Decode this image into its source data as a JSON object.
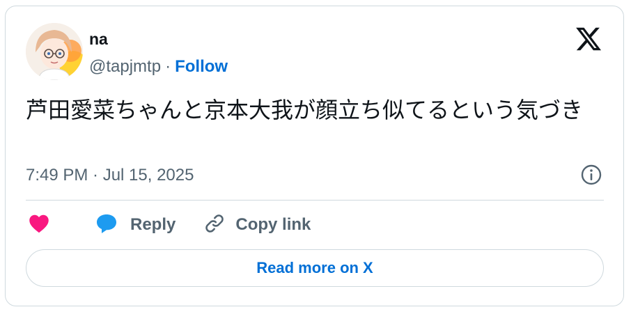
{
  "author": {
    "display_name": "na",
    "handle": "@tapjmtp",
    "separator": "·",
    "follow_label": "Follow"
  },
  "tweet": {
    "text": "芦田愛菜ちゃんと京本大我が顔立ち似てるという気づき",
    "timestamp": "7:49 PM · Jul 15, 2025"
  },
  "actions": {
    "like_icon": "heart-icon",
    "reply_label": "Reply",
    "copy_label": "Copy link"
  },
  "read_more_label": "Read more on X",
  "colors": {
    "accent": "#006fd6",
    "heart": "#f91880",
    "reply_bubble": "#1d9bf0",
    "muted": "#536471",
    "border": "#cfd9de"
  }
}
